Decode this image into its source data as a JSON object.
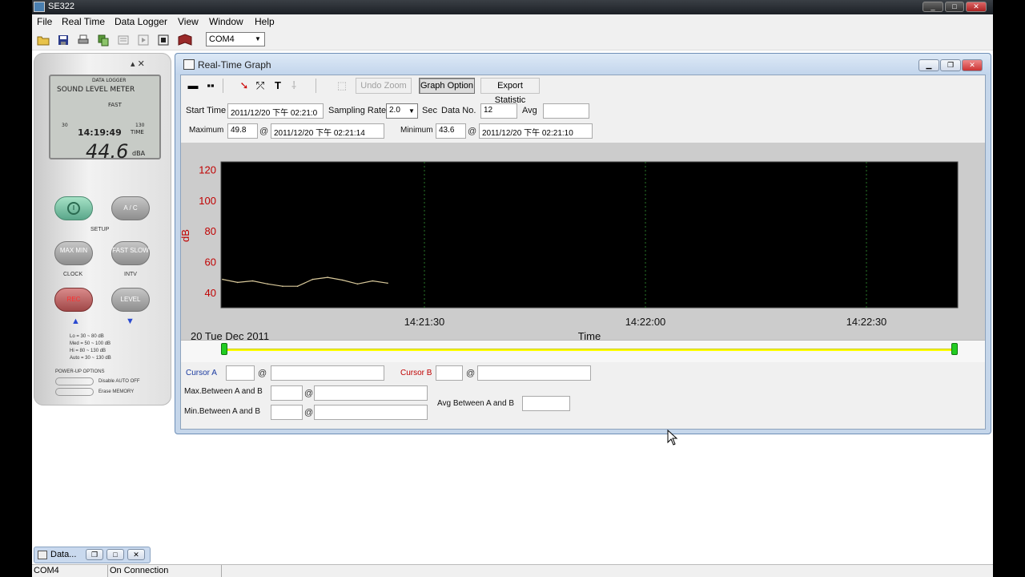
{
  "window": {
    "title": "SE322"
  },
  "menu": [
    "File",
    "Real Time",
    "Data Logger",
    "View",
    "Window",
    "Help"
  ],
  "toolbar": {
    "port_value": "COM4"
  },
  "meter": {
    "header1": "DATA LOGGER",
    "header2": "SOUND LEVEL METER",
    "mode": "FAST",
    "range_low": "30",
    "range_high": "130",
    "time": "14:19:49",
    "time_label": "TIME",
    "reading": "44.6",
    "unit": "dBA",
    "btn_power": "I",
    "btn_ac": "A / C",
    "setup_label": "SETUP",
    "btn_maxmin": "MAX MIN",
    "btn_fastslow": "FAST SLOW",
    "clock_label": "CLOCK",
    "intv_label": "INTV",
    "btn_rec": "REC",
    "btn_level": "LEVEL",
    "ranges": [
      "Lo = 30 ~ 80 dB",
      "Med = 50 ~ 100 dB",
      "Hi = 80 ~ 130 dB",
      "Auto = 30 ~ 130 dB"
    ],
    "power_up": "POWER-UP OPTIONS",
    "opt1": "Disable AUTO OFF",
    "opt2": "Erase MEMORY"
  },
  "child": {
    "title": "Real-Time Graph",
    "buttons": {
      "undo_zoom": "Undo Zoom",
      "graph_option": "Graph Option",
      "export_statistic": "Export Statistic"
    },
    "fields": {
      "start_time_label": "Start Time",
      "start_time": "2011/12/20 下午 02:21:0",
      "sampling_rate_label": "Sampling Rate",
      "sampling_rate": "2.0",
      "sec_label": "Sec",
      "data_no_label": "Data No.",
      "data_no": "12",
      "avg_label": "Avg",
      "avg": "",
      "maximum_label": "Maximum",
      "maximum": "49.8",
      "maximum_at": "2011/12/20 下午 02:21:14",
      "minimum_label": "Minimum",
      "minimum": "43.6",
      "minimum_at": "2011/12/20 下午 02:21:10",
      "at_symbol": "@"
    },
    "cursor": {
      "a_label": "Cursor A",
      "b_label": "Cursor B",
      "max_between": "Max.Between A and B",
      "min_between": "Min.Between A and B",
      "avg_between": "Avg Between A and B"
    }
  },
  "chart_data": {
    "type": "line",
    "ylabel": "dB",
    "xlabel": "Time",
    "date_label": "20 Tue Dec 2011",
    "ylim": [
      30,
      125
    ],
    "yticks": [
      40,
      60,
      80,
      100,
      120
    ],
    "xticks": [
      "14:21:30",
      "14:22:00",
      "14:22:30"
    ],
    "x_seconds": [
      0,
      2,
      4,
      6,
      8,
      10,
      12,
      14,
      16,
      18,
      20,
      22
    ],
    "values": [
      48.5,
      46.5,
      47.5,
      45.5,
      44.0,
      44.0,
      48.5,
      49.8,
      48.0,
      45.5,
      47.5,
      46.0
    ],
    "line_color": "#d8c89a",
    "background": "#000000",
    "grid_color": "#2a7a2a"
  },
  "status": {
    "port": "COM4",
    "connection": "On Connection"
  },
  "minimized": {
    "label": "Data..."
  }
}
